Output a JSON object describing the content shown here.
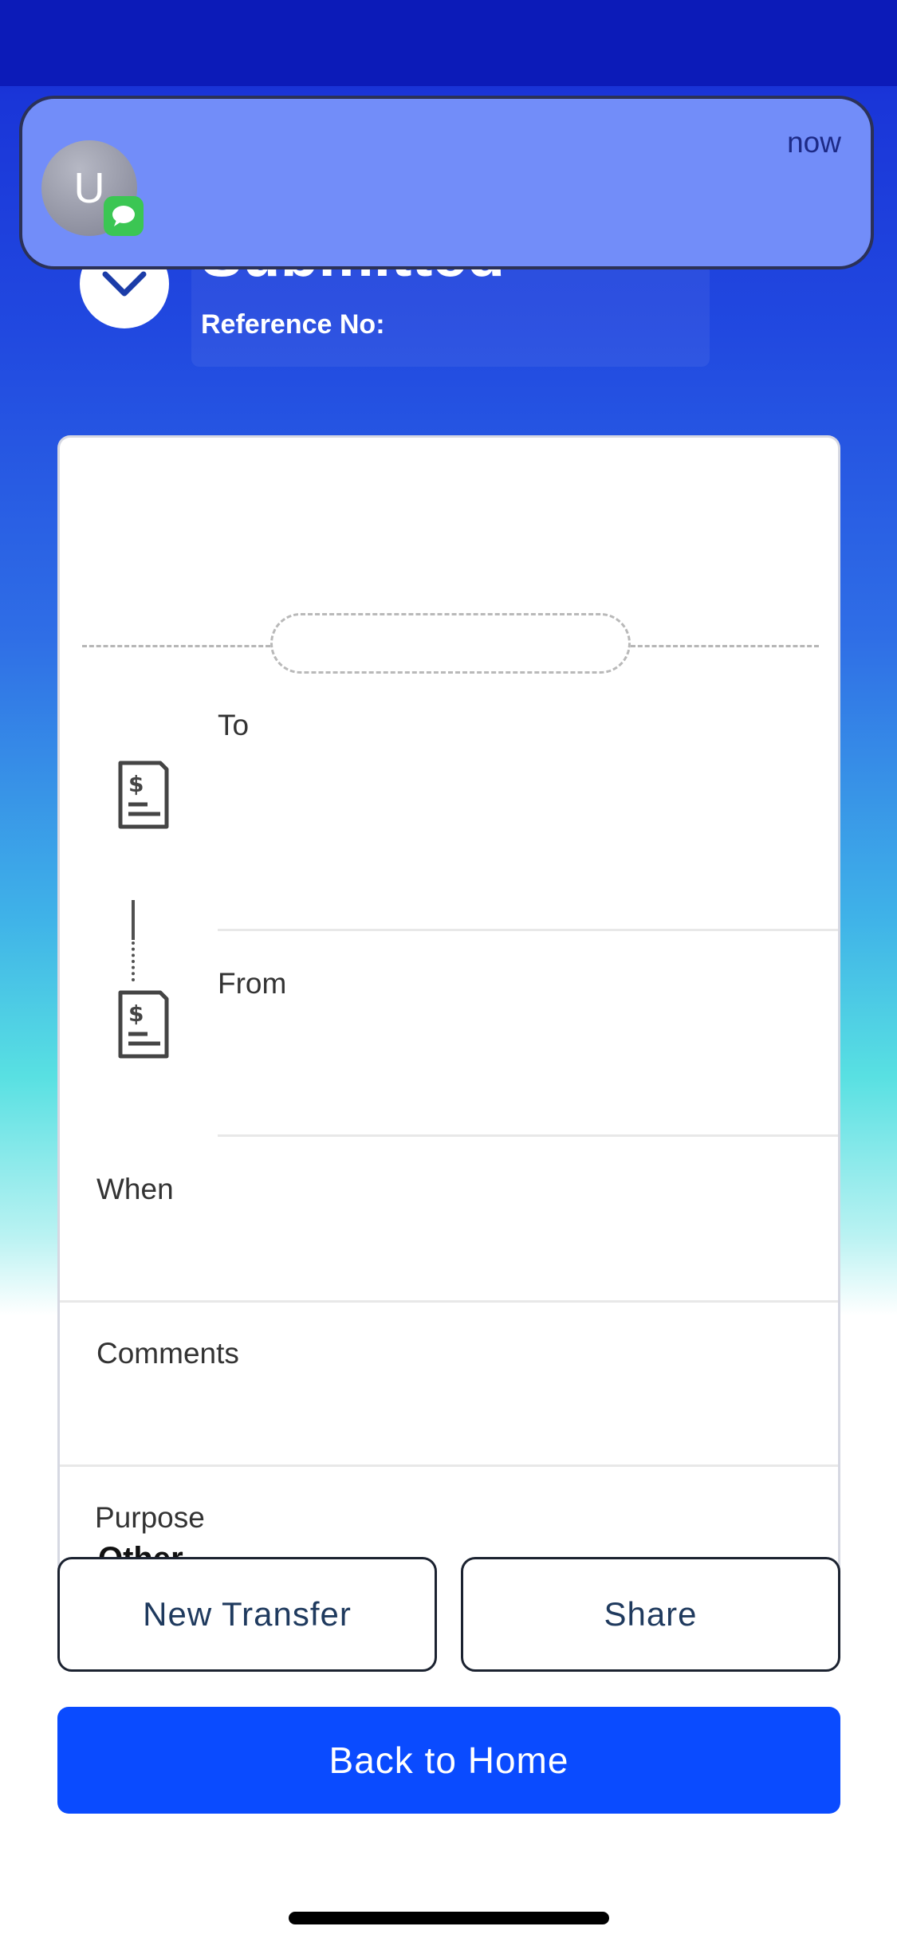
{
  "notification": {
    "avatar_letter": "U",
    "time": "now",
    "icons": {
      "badge": "message-bubble-icon"
    }
  },
  "header": {
    "title": "Submitted",
    "reference_label": "Reference No:",
    "icons": {
      "status": "checkmark-icon"
    }
  },
  "details": {
    "to_label": "To",
    "from_label": "From",
    "when_label": "When",
    "comments_label": "Comments",
    "purpose_label": "Purpose",
    "purpose_value": "Other",
    "icons": {
      "account": "dollar-document-icon"
    }
  },
  "actions": {
    "new_transfer_label": "New Transfer",
    "share_label": "Share",
    "back_home_label": "Back to Home"
  },
  "colors": {
    "primary": "#0a4bff",
    "header_blue": "#1a35d8",
    "notification_bg": "#728df9",
    "message_green": "#3bc653"
  }
}
